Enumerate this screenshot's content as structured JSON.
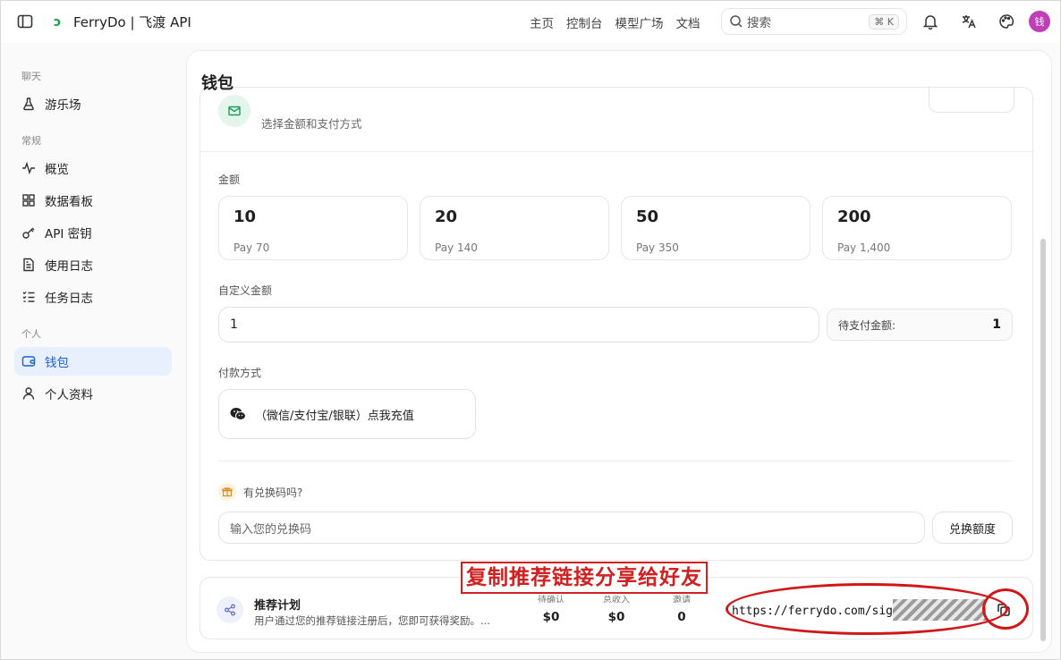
{
  "app": {
    "title": "FerryDo | 飞渡 API"
  },
  "nav": [
    "主页",
    "控制台",
    "模型广场",
    "文档"
  ],
  "search": {
    "placeholder": "搜索",
    "shortcut": "⌘ K"
  },
  "user": {
    "avatar_text": "钱",
    "avatar_color": "#c13fb6"
  },
  "sidebar": {
    "sections": [
      {
        "label": "聊天",
        "items": [
          {
            "label": "游乐场",
            "icon": "flask-icon"
          }
        ]
      },
      {
        "label": "常规",
        "items": [
          {
            "label": "概览",
            "icon": "activity-icon"
          },
          {
            "label": "数据看板",
            "icon": "grid-icon"
          },
          {
            "label": "API 密钥",
            "icon": "key-icon"
          },
          {
            "label": "使用日志",
            "icon": "file-text-icon"
          },
          {
            "label": "任务日志",
            "icon": "list-checks-icon"
          }
        ]
      },
      {
        "label": "个人",
        "items": [
          {
            "label": "钱包",
            "icon": "wallet-icon",
            "active": true
          },
          {
            "label": "个人资料",
            "icon": "user-icon"
          }
        ]
      }
    ]
  },
  "page": {
    "title": "钱包"
  },
  "topup": {
    "title_partial": "",
    "subtitle": "选择金额和支付方式",
    "amount_label": "金额",
    "amounts": [
      {
        "value": "10",
        "pay": "Pay 70"
      },
      {
        "value": "20",
        "pay": "Pay 140"
      },
      {
        "value": "50",
        "pay": "Pay 350"
      },
      {
        "value": "200",
        "pay": "Pay 1,400"
      }
    ],
    "custom_label": "自定义金额",
    "custom_value": "1",
    "pending_label": "待支付金额:",
    "pending_value": "1",
    "method_label": "付款方式",
    "method_button": "（微信/支付宝/银联）点我充值",
    "redeem_prompt": "有兑换码吗?",
    "redeem_placeholder": "输入您的兑换码",
    "redeem_button": "兑换额度"
  },
  "referral": {
    "title": "推荐计划",
    "description": "用户通过您的推荐链接注册后，您即可获得奖励。...",
    "stats": [
      {
        "label": "待确认",
        "value": "$0"
      },
      {
        "label": "总收入",
        "value": "$0"
      },
      {
        "label": "邀请",
        "value": "0"
      }
    ],
    "link": "https://ferrydo.com/sig"
  },
  "annotation": {
    "text": "复制推荐链接分享给好友",
    "color": "#d0181a"
  }
}
